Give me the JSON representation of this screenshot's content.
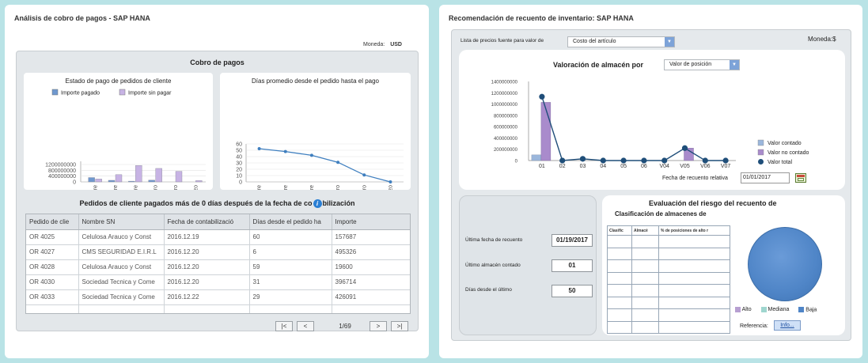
{
  "left": {
    "title": "Análisis de cobro de pagos - SAP HANA",
    "currency_label": "Moneda:",
    "currency_value": "USD",
    "panel_title": "Cobro de pagos",
    "chart1_title": "Estado de pago de pedidos de cliente",
    "chart2_title": "Días promedio desde el pedido hasta el pago",
    "table_title": "Pedidos de cliente pagados más de 0 días después de la fecha de contabilización",
    "table_title_left": "Pedidos de cliente pagados más de 0 días después de la fecha de co",
    "table_title_right": "bilización",
    "columns": [
      "Pedido de clie",
      "Nombre SN",
      "Fecha de contabilizació",
      "Días desde el pedido ha",
      "Importe"
    ],
    "rows": [
      [
        "OR 4025",
        "Celulosa Arauco y Const",
        "2016.12.19",
        "60",
        "157687"
      ],
      [
        "OR 4027",
        "CMS SEGURIDAD E.I.R.L",
        "2016.12.20",
        "6",
        "495326"
      ],
      [
        "OR 4028",
        "Celulosa Arauco y Const",
        "2016.12.20",
        "59",
        "19600"
      ],
      [
        "OR 4030",
        "Sociedad Tecnica y Come",
        "2016.12.20",
        "31",
        "396714"
      ],
      [
        "OR 4033",
        "Sociedad Tecnica y Come",
        "2016.12.22",
        "29",
        "426091"
      ]
    ],
    "pager": {
      "first": "|<",
      "prev": "<",
      "page": "1/69",
      "next": ">",
      "last": ">|"
    },
    "info_icon": "info-icon"
  },
  "right": {
    "title": "Recomendación de recuento de inventario: SAP HANA",
    "price_list_label": "Lista de precios fuente para valor de",
    "price_list_value": "Costo del artículo",
    "currency": "Moneda:$",
    "valuation_title": "Valoración de almacén por",
    "valuation_select": "Valor de posición",
    "date_label": "Fecha de recuento relativa",
    "date_value": "01/01/2017",
    "calendar_icon": "calendar-icon",
    "last_count_date_label": "Última fecha de recuento",
    "last_count_date_value": "01/19/2017",
    "last_wh_label": "Último almacén contado",
    "last_wh_value": "01",
    "days_label": "Días desde el último",
    "days_value": "50",
    "risk_title": "Evaluación del riesgo del recuento de",
    "risk_subtitle": "Clasificación de almacenes de",
    "risk_columns": [
      "Clasific",
      "Almacé",
      "% de posiciones de alto r"
    ],
    "risk_legend": [
      {
        "label": "Alto",
        "color": "#b79fd1"
      },
      {
        "label": "Mediana",
        "color": "#9fd6cf"
      },
      {
        "label": "Baja",
        "color": "#4f85c7"
      }
    ],
    "ref_label": "Referencia:",
    "info_button": "Info...",
    "pie_color": "#4f85c7"
  },
  "chart_data": [
    {
      "type": "bar",
      "title": "Estado de pago de pedidos de cliente",
      "categories": [
        "Octubre",
        "Noviembre",
        "Diciembre",
        "Enero",
        "Febrero",
        "Marzo"
      ],
      "series": [
        {
          "name": "Importe pagado",
          "color": "#6f98cf",
          "values": [
            300000000,
            110000000,
            50000000,
            120000000,
            0,
            0
          ]
        },
        {
          "name": "Importe sin pagar",
          "color": "#c7b3e4",
          "values": [
            200000000,
            500000000,
            1130000000,
            930000000,
            730000000,
            90000000
          ]
        }
      ],
      "ylim": [
        0,
        1200000000
      ],
      "yticks": [
        "1200000000",
        "800000000",
        "400000000",
        "0"
      ]
    },
    {
      "type": "line",
      "title": "Días promedio desde el pedido hasta el pago",
      "categories": [
        "Octubre",
        "Noviembre",
        "Diciembre",
        "Enero",
        "Febrero",
        "Marzo"
      ],
      "series": [
        {
          "name": "",
          "color": "#3f7fbf",
          "values": [
            52.5,
            48,
            42,
            31,
            11,
            0
          ]
        }
      ],
      "ylim": [
        0,
        60
      ],
      "yticks": [
        "60",
        "50",
        "40",
        "30",
        "20",
        "10",
        "0"
      ]
    },
    {
      "type": "bar",
      "title": "Valoración de almacén por",
      "categories": [
        "01",
        "02",
        "03",
        "04",
        "05",
        "06",
        "V04",
        "V05",
        "V06",
        "V07"
      ],
      "series": [
        {
          "name": "Valor contado",
          "color": "#9bb7dc",
          "type": "bar",
          "values": [
            100000000,
            0,
            0,
            0,
            0,
            0,
            0,
            0,
            0,
            0
          ]
        },
        {
          "name": "Valor no contado",
          "color": "#a98bcc",
          "type": "bar",
          "values": [
            1030000000,
            0,
            0,
            0,
            0,
            0,
            0,
            220000000,
            0,
            0
          ]
        },
        {
          "name": "Valor total",
          "color": "#1f4e79",
          "type": "line",
          "values": [
            1130000000,
            0,
            30000000,
            0,
            0,
            0,
            0,
            220000000,
            0,
            0
          ]
        }
      ],
      "ylim": [
        0,
        1400000000
      ],
      "yticks": [
        "1400000000",
        "1200000000",
        "1000000000",
        "800000000",
        "600000000",
        "400000000",
        "200000000",
        "0"
      ]
    }
  ]
}
